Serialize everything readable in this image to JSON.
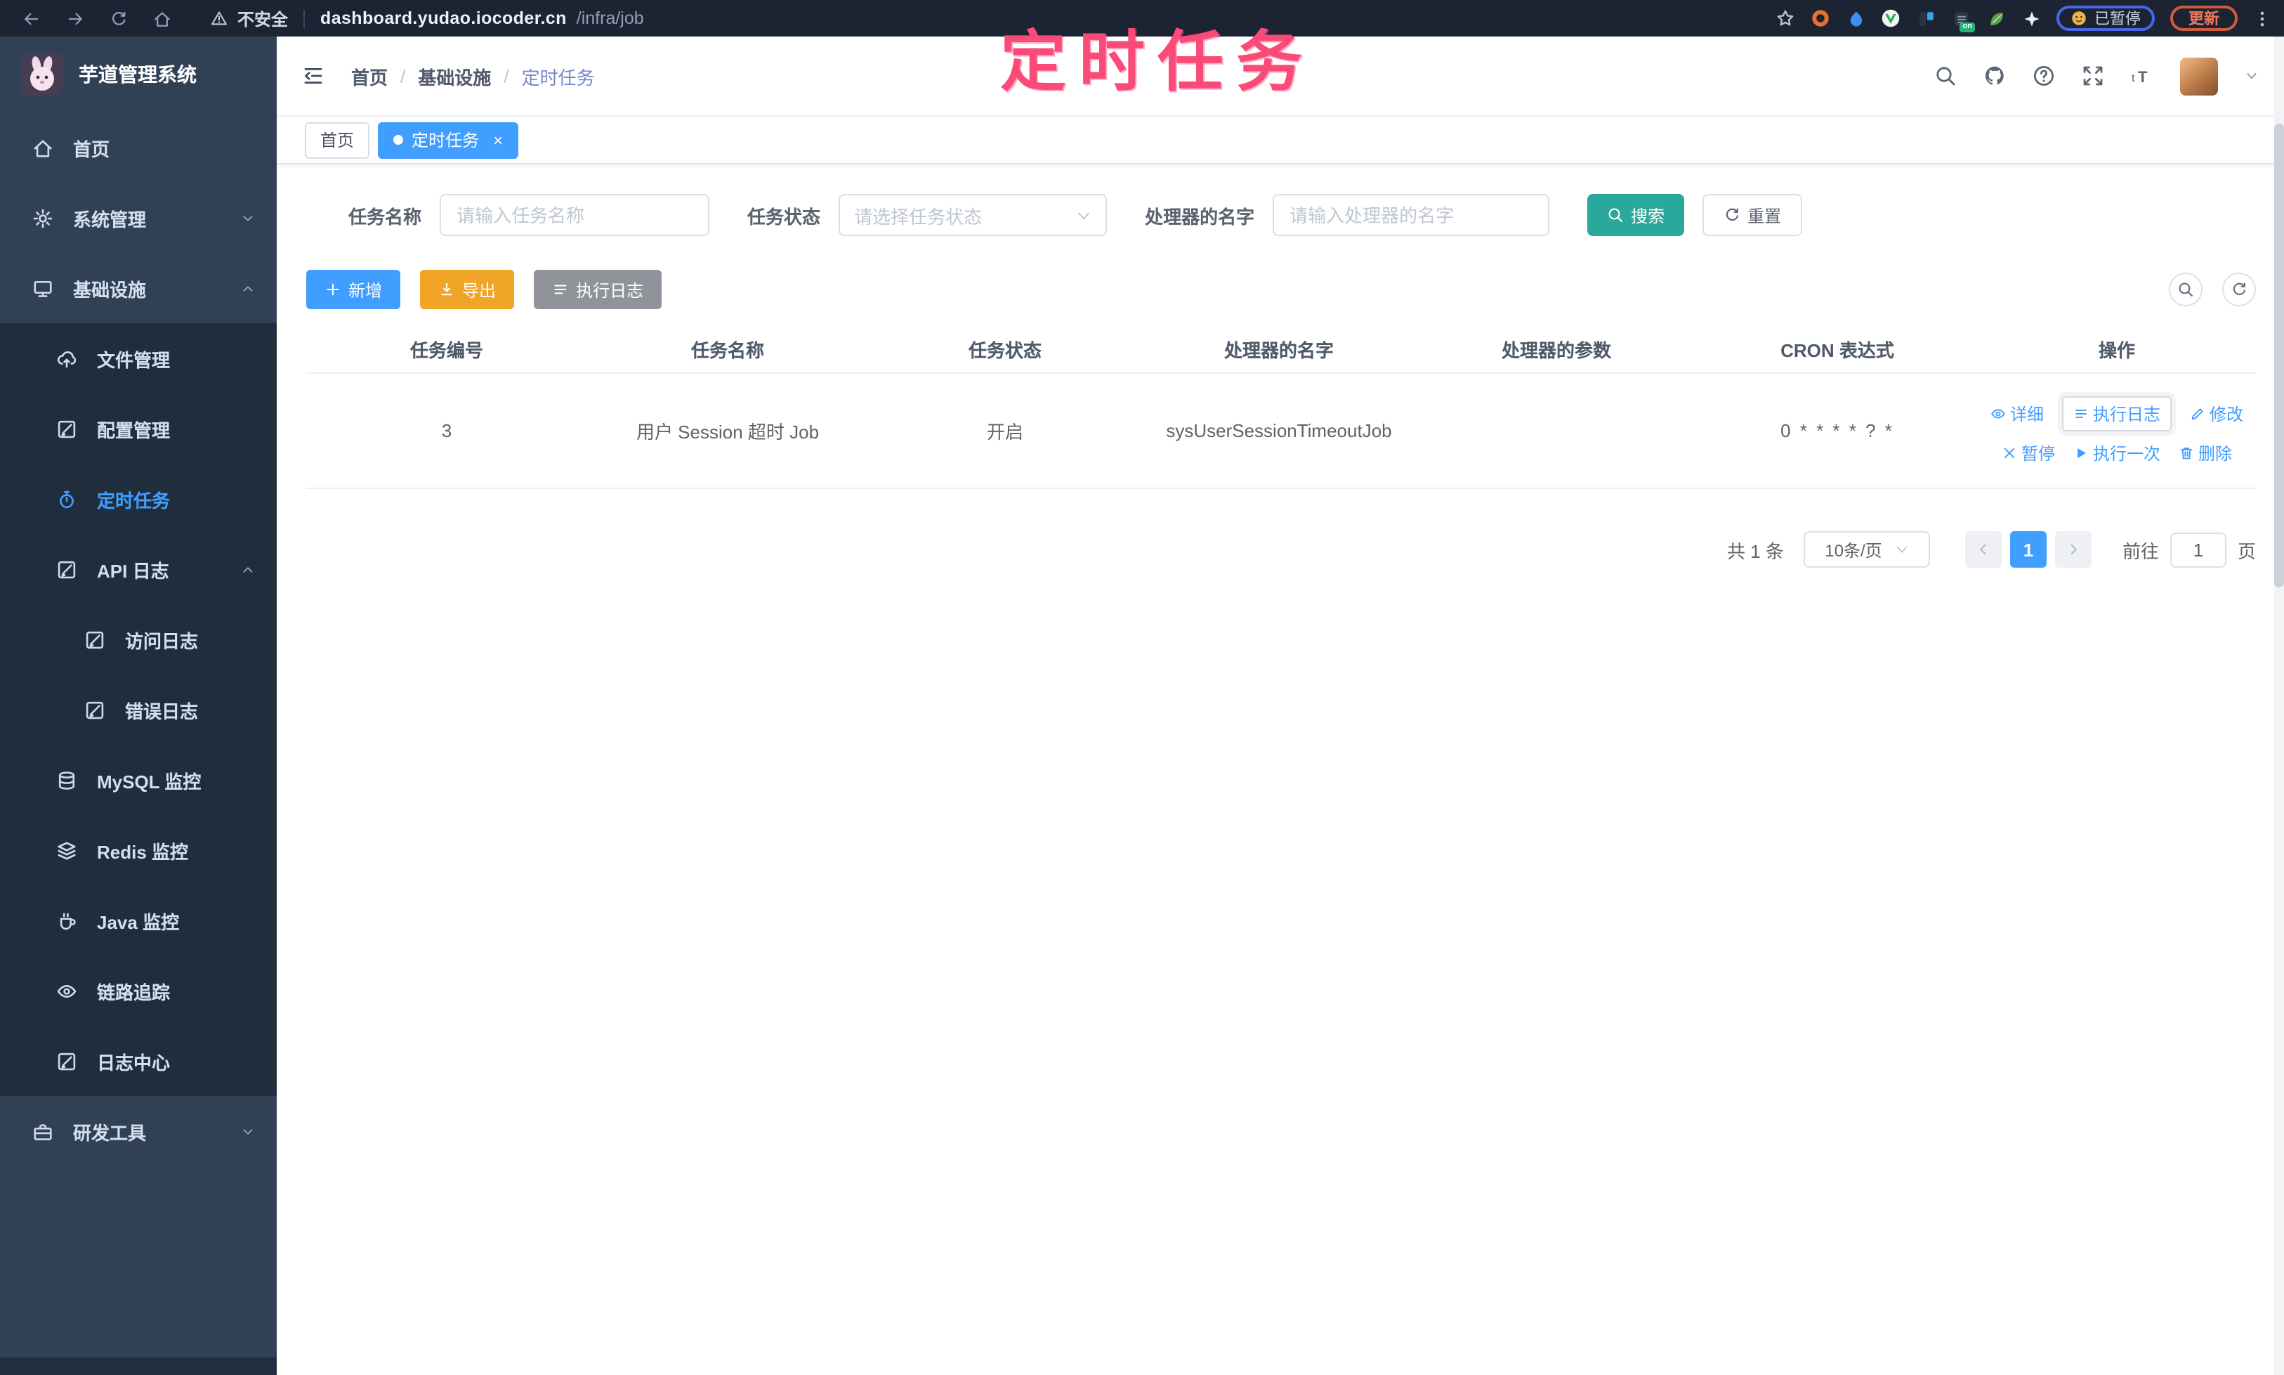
{
  "browser": {
    "security_label": "不安全",
    "url_host": "dashboard.yudao.iocoder.cn",
    "url_path": "/infra/job",
    "on_badge": "on",
    "extensions_paused_label": "已暂停",
    "update_label": "更新"
  },
  "annotation": {
    "text": "定时任务",
    "color": "#fa4a78"
  },
  "sidebar": {
    "title": "芋道管理系统",
    "items": [
      {
        "label": "首页"
      },
      {
        "label": "系统管理"
      },
      {
        "label": "基础设施"
      },
      {
        "label": "文件管理"
      },
      {
        "label": "配置管理"
      },
      {
        "label": "定时任务"
      },
      {
        "label": "API 日志"
      },
      {
        "label": "访问日志"
      },
      {
        "label": "错误日志"
      },
      {
        "label": "MySQL 监控"
      },
      {
        "label": "Redis 监控"
      },
      {
        "label": "Java 监控"
      },
      {
        "label": "链路追踪"
      },
      {
        "label": "日志中心"
      },
      {
        "label": "研发工具"
      }
    ]
  },
  "header": {
    "breadcrumb": {
      "items": [
        "首页",
        "基础设施",
        "定时任务"
      ],
      "separator": "/"
    }
  },
  "tabs": [
    {
      "label": "首页"
    },
    {
      "label": "定时任务"
    }
  ],
  "filters": {
    "name_label": "任务名称",
    "name_placeholder": "请输入任务名称",
    "status_label": "任务状态",
    "status_placeholder": "请选择任务状态",
    "handler_label": "处理器的名字",
    "handler_placeholder": "请输入处理器的名字",
    "search_label": "搜索",
    "reset_label": "重置"
  },
  "toolbar": {
    "add_label": "新增",
    "export_label": "导出",
    "exec_log_label": "执行日志"
  },
  "table": {
    "headers": [
      "任务编号",
      "任务名称",
      "任务状态",
      "处理器的名字",
      "处理器的参数",
      "CRON 表达式",
      "操作"
    ],
    "rows": [
      {
        "id": "3",
        "name": "用户 Session 超时 Job",
        "status": "开启",
        "handler": "sysUserSessionTimeoutJob",
        "param": "",
        "cron": "0 * * * * ? *",
        "actions": [
          "详细",
          "执行日志",
          "修改",
          "暂停",
          "执行一次",
          "删除"
        ]
      }
    ]
  },
  "pagination": {
    "total": "共 1 条",
    "page_size": "10条/页",
    "page": "1",
    "goto_label": "前往",
    "goto_value": "1",
    "unit_label": "页"
  },
  "colors": {
    "accent": "#409eff",
    "search_teal": "#2ba89c",
    "export_orange": "#f0a526",
    "info_gray": "#909399",
    "sidebar_bg": "#304156",
    "submenu_bg": "#1f2d3d",
    "annotation_pink": "#fa4a78"
  }
}
